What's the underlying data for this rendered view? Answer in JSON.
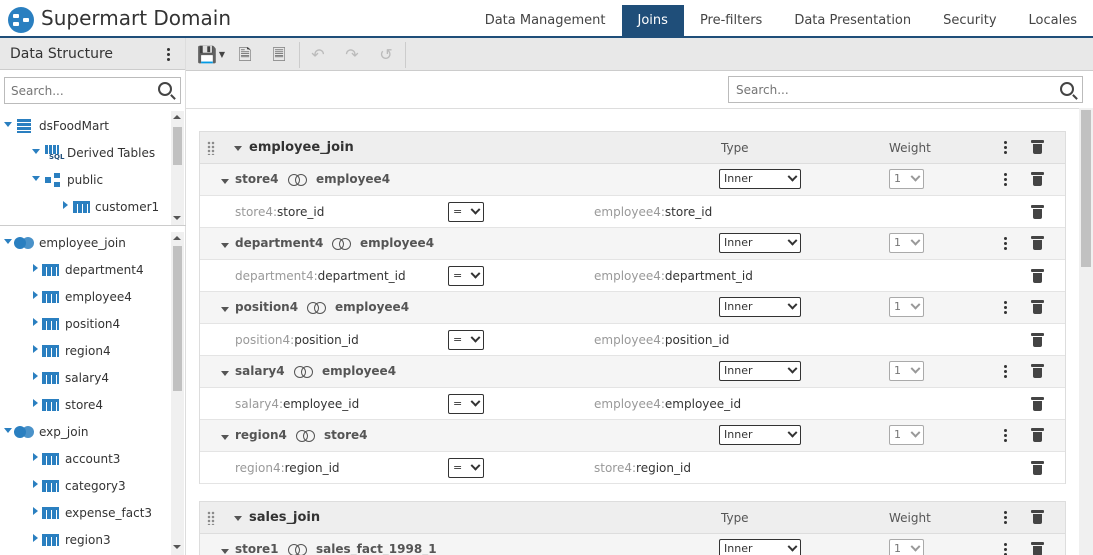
{
  "app": {
    "title": "Supermart Domain"
  },
  "tabs": [
    "Data Management",
    "Joins",
    "Pre-filters",
    "Data Presentation",
    "Security",
    "Locales"
  ],
  "active_tab": "Joins",
  "left_panel": {
    "title": "Data Structure",
    "search_placeholder": "Search...",
    "tree_top": [
      {
        "label": "dsFoodMart",
        "icon": "database-icon",
        "level": 0,
        "expanded": true
      },
      {
        "label": "Derived Tables",
        "icon": "sql-icon",
        "level": 1,
        "expanded": true
      },
      {
        "label": "public",
        "icon": "schema-icon",
        "level": 1,
        "expanded": true
      },
      {
        "label": "customer1",
        "icon": "table-icon",
        "level": 2,
        "expanded": false
      }
    ],
    "tree_joins": [
      {
        "label": "employee_join",
        "icon": "join-icon",
        "level": 0,
        "expanded": true
      },
      {
        "label": "department4",
        "icon": "table-icon",
        "level": 1
      },
      {
        "label": "employee4",
        "icon": "table-icon",
        "level": 1
      },
      {
        "label": "position4",
        "icon": "table-icon",
        "level": 1
      },
      {
        "label": "region4",
        "icon": "table-icon",
        "level": 1
      },
      {
        "label": "salary4",
        "icon": "table-icon",
        "level": 1
      },
      {
        "label": "store4",
        "icon": "table-icon",
        "level": 1
      },
      {
        "label": "exp_join",
        "icon": "join-icon",
        "level": 0,
        "expanded": true
      },
      {
        "label": "account3",
        "icon": "table-icon",
        "level": 1
      },
      {
        "label": "category3",
        "icon": "table-icon",
        "level": 1
      },
      {
        "label": "expense_fact3",
        "icon": "table-icon",
        "level": 1
      },
      {
        "label": "region3",
        "icon": "table-icon",
        "level": 1
      }
    ]
  },
  "toolbar": {
    "buttons": [
      "save-icon",
      "export-icon",
      "import-icon",
      "undo-icon",
      "redo-icon",
      "undo-all-icon"
    ]
  },
  "main_search_placeholder": "Search...",
  "join_headers": {
    "type": "Type",
    "weight": "Weight"
  },
  "joins": [
    {
      "name": "employee_join",
      "relations": [
        {
          "left": "store4",
          "right": "employee4",
          "type": "Inner",
          "weight": "1",
          "cond": {
            "lt": "store4:",
            "lf": "store_id",
            "op": "=",
            "rt": "employee4:",
            "rf": "store_id"
          }
        },
        {
          "left": "department4",
          "right": "employee4",
          "type": "Inner",
          "weight": "1",
          "cond": {
            "lt": "department4:",
            "lf": "department_id",
            "op": "=",
            "rt": "employee4:",
            "rf": "department_id"
          }
        },
        {
          "left": "position4",
          "right": "employee4",
          "type": "Inner",
          "weight": "1",
          "cond": {
            "lt": "position4:",
            "lf": "position_id",
            "op": "=",
            "rt": "employee4:",
            "rf": "position_id"
          }
        },
        {
          "left": "salary4",
          "right": "employee4",
          "type": "Inner",
          "weight": "1",
          "cond": {
            "lt": "salary4:",
            "lf": "employee_id",
            "op": "=",
            "rt": "employee4:",
            "rf": "employee_id"
          }
        },
        {
          "left": "region4",
          "right": "store4",
          "type": "Inner",
          "weight": "1",
          "cond": {
            "lt": "region4:",
            "lf": "region_id",
            "op": "=",
            "rt": "store4:",
            "rf": "region_id"
          }
        }
      ]
    },
    {
      "name": "sales_join",
      "relations": [
        {
          "left": "store1",
          "right": "sales_fact_1998_1",
          "type": "Inner",
          "weight": "1"
        }
      ]
    }
  ],
  "colors": {
    "brand": "#1f4e79",
    "accent": "#2a7fc0"
  }
}
